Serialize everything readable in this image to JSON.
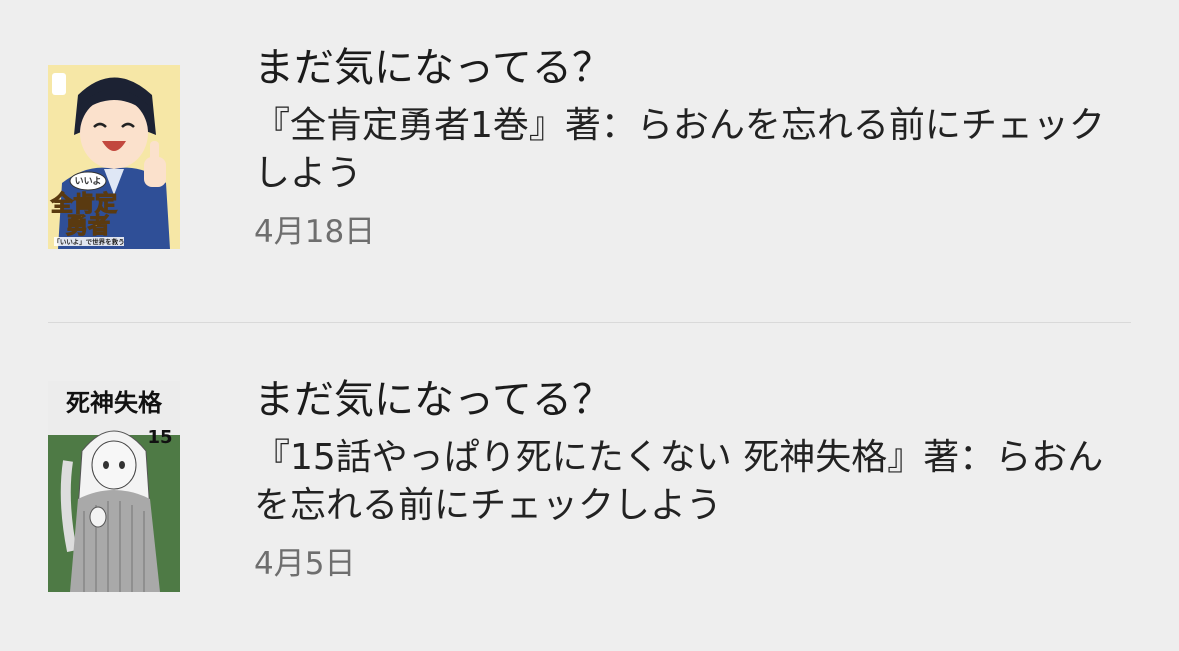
{
  "notifications": [
    {
      "title": "まだ気になってる？",
      "body": "『全肯定勇者1巻』著：らおんを忘れる前にチェックしよう",
      "date": "4月18日",
      "cover": {
        "title_line1": "全肯定",
        "title_line2": "勇者",
        "caption": "「いいよ」で世界を救う",
        "speech": "いいよ",
        "colors": {
          "bg": "#f6e7a6",
          "uniform": "#2f4f97",
          "hair": "#1c2233",
          "title": "#f0c34a"
        }
      }
    },
    {
      "title": "まだ気になってる？",
      "body": "『15話やっぱり死にたくない 死神失格』著：らおんを忘れる前にチェックしよう",
      "date": "4月5日",
      "cover": {
        "title": "死神失格",
        "number": "15",
        "colors": {
          "bg": "#4e7a45",
          "panel": "#ececec",
          "text": "#111111"
        }
      }
    }
  ]
}
